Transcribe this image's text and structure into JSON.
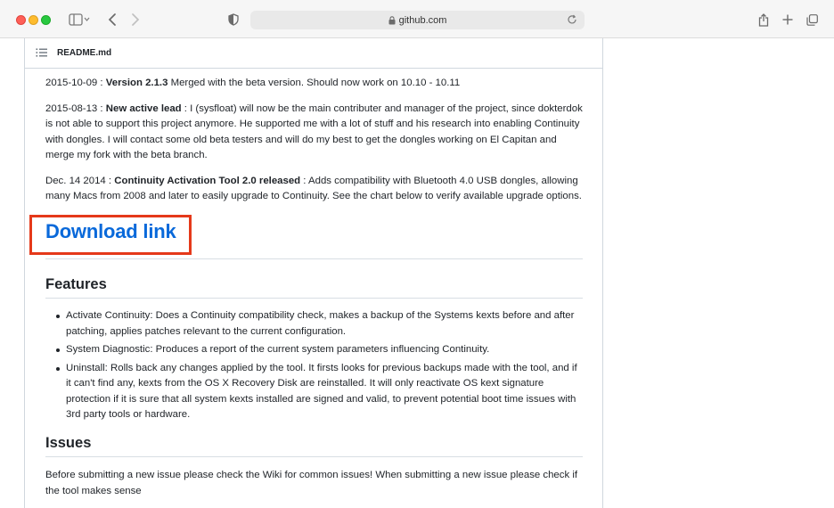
{
  "browser": {
    "url": "github.com"
  },
  "readme": {
    "filename": "README.md",
    "news": [
      {
        "date": "2015-10-09 : ",
        "bold": "Version 2.1.3",
        "rest": " Merged with the beta version. Should now work on 10.10 - 10.11"
      },
      {
        "date": "2015-08-13 : ",
        "bold": "New active lead",
        "rest": " : I (sysfloat) will now be the main contributer and manager of the project, since dokterdok is not able to support this project anymore. He supported me with a lot of stuff and his research into enabling Continuity with dongles. I will contact some old beta testers and will do my best to get the dongles working on El Capitan and merge my fork with the beta branch."
      },
      {
        "date": "Dec. 14 2014 : ",
        "bold": "Continuity Activation Tool 2.0 released",
        "rest": " : Adds compatibility with Bluetooth 4.0 USB dongles, allowing many Macs from 2008 and later to easily upgrade to Continuity. See the chart below to verify available upgrade options."
      }
    ],
    "download_link": "Download link",
    "features_heading": "Features",
    "features": [
      "Activate Continuity: Does a Continuity compatibility check, makes a backup of the Systems kexts before and after patching, applies patches relevant to the current configuration.",
      "System Diagnostic: Produces a report of the current system parameters influencing Continuity.",
      "Uninstall: Rolls back any changes applied by the tool. It firsts looks for previous backups made with the tool, and if it can't find any, kexts from the OS X Recovery Disk are reinstalled. It will only reactivate OS kext signature protection if it is sure that all system kexts installed are signed and valid, to prevent potential boot time issues with 3rd party tools or hardware."
    ],
    "issues_heading": "Issues",
    "issues_text": "Before submitting a new issue please check the Wiki for common issues! When submitting a new issue please check if the tool makes sense"
  }
}
